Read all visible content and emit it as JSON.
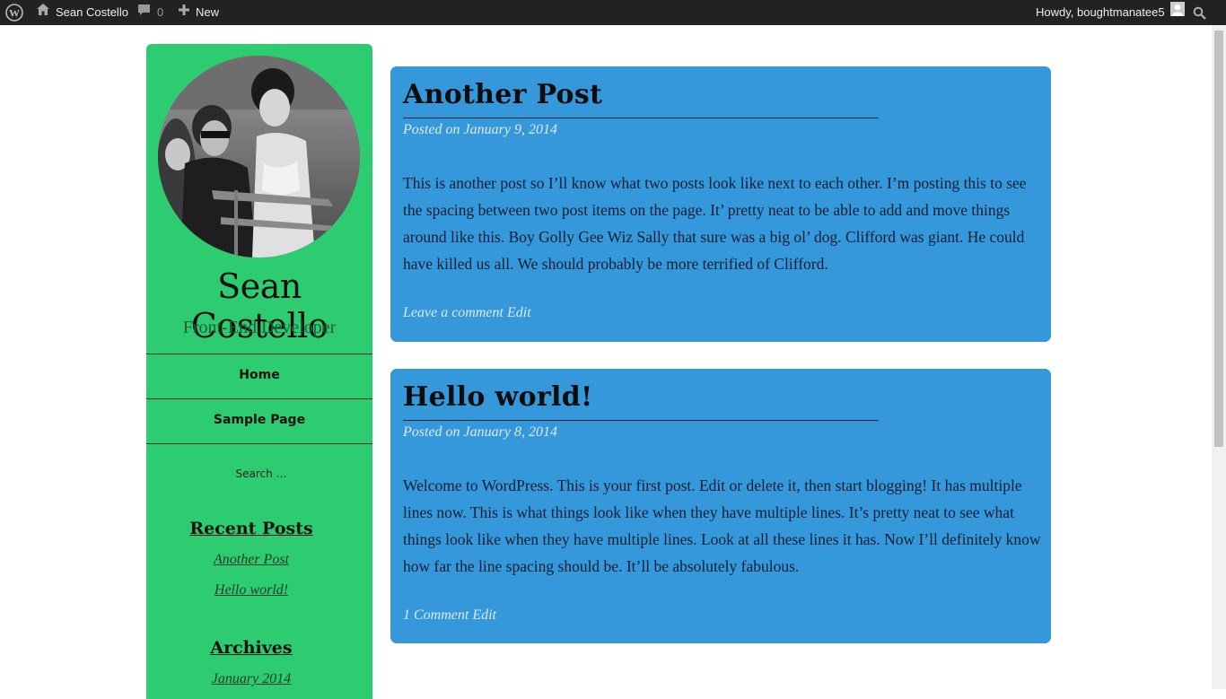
{
  "admin_bar": {
    "site_name": "Sean Costello",
    "comments_count": "0",
    "new_label": "New",
    "greeting": "Howdy, boughtmanatee5"
  },
  "sidebar": {
    "site_title": "Sean Costello",
    "site_description": "Front-End Developer",
    "nav": [
      {
        "label": "Home"
      },
      {
        "label": "Sample Page"
      }
    ],
    "search_placeholder": "Search …",
    "recent_posts_title": "Recent Posts",
    "recent_posts": [
      {
        "label": "Another Post"
      },
      {
        "label": "Hello world!"
      }
    ],
    "archives_title": "Archives",
    "archives": [
      {
        "label": "January 2014"
      }
    ]
  },
  "posts": [
    {
      "title": "Another Post",
      "posted_on_label": "Posted on",
      "date": "January 9, 2014",
      "body": "This is another post so I’ll know what two posts look like next to each other. I’m posting this to see the spacing between two post items on the page. It’ pretty neat to be able to add and move things around like this. Boy Golly Gee Wiz Sally that sure was a big ol’ dog. Clifford was giant. He could have killed us all. We should probably be more terrified of Clifford.",
      "comment_link": "Leave a comment",
      "edit_link": "Edit"
    },
    {
      "title": "Hello world!",
      "posted_on_label": "Posted on",
      "date": "January 8, 2014",
      "body": "Welcome to WordPress. This is your first post. Edit or delete it, then start blogging! It has multiple lines now. This is what things look like when they have multiple lines. It’s pretty neat to see what things look like when they have multiple lines. Look at all these lines it has.  Now I’ll definitely know how far the line spacing should be. It’ll be absolutely fabulous.",
      "comment_link": "1 Comment",
      "edit_link": "Edit"
    }
  ],
  "colors": {
    "sidebar_bg": "#2ecc71",
    "post_bg": "#3498db",
    "admin_bar_bg": "#222222"
  }
}
